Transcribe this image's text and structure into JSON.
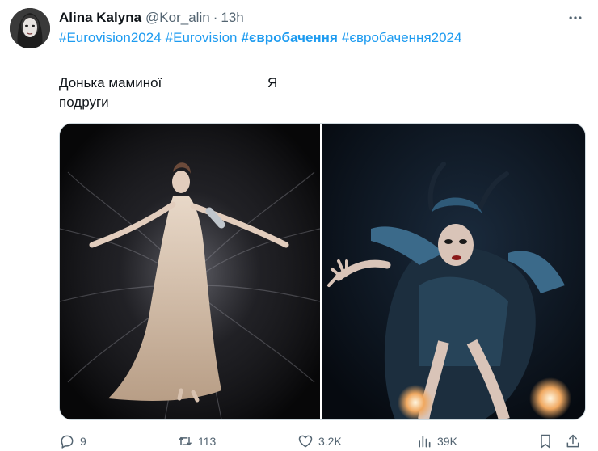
{
  "tweet": {
    "author_name": "Alina Kalyna",
    "handle": "@Kor_alin",
    "separator": "·",
    "time": "13h",
    "hashtags": [
      "#Eurovision2024",
      "#Eurovision",
      "#євробачення",
      "#євробачення2024"
    ],
    "caption_line1": "Донька маминої",
    "caption_line2": "подруги",
    "caption_right": "Я"
  },
  "actions": {
    "replies": "9",
    "reposts": "113",
    "likes": "3.2K",
    "views": "39K"
  },
  "colors": {
    "link": "#1d9bf0",
    "muted": "#536471",
    "text": "#0f1419",
    "border": "#cfd9de"
  },
  "icons": {
    "more": "more-horizontal-icon",
    "reply": "reply-icon",
    "repost": "repost-icon",
    "like": "heart-icon",
    "views": "views-bar-chart-icon",
    "bookmark": "bookmark-icon",
    "share": "share-icon"
  }
}
